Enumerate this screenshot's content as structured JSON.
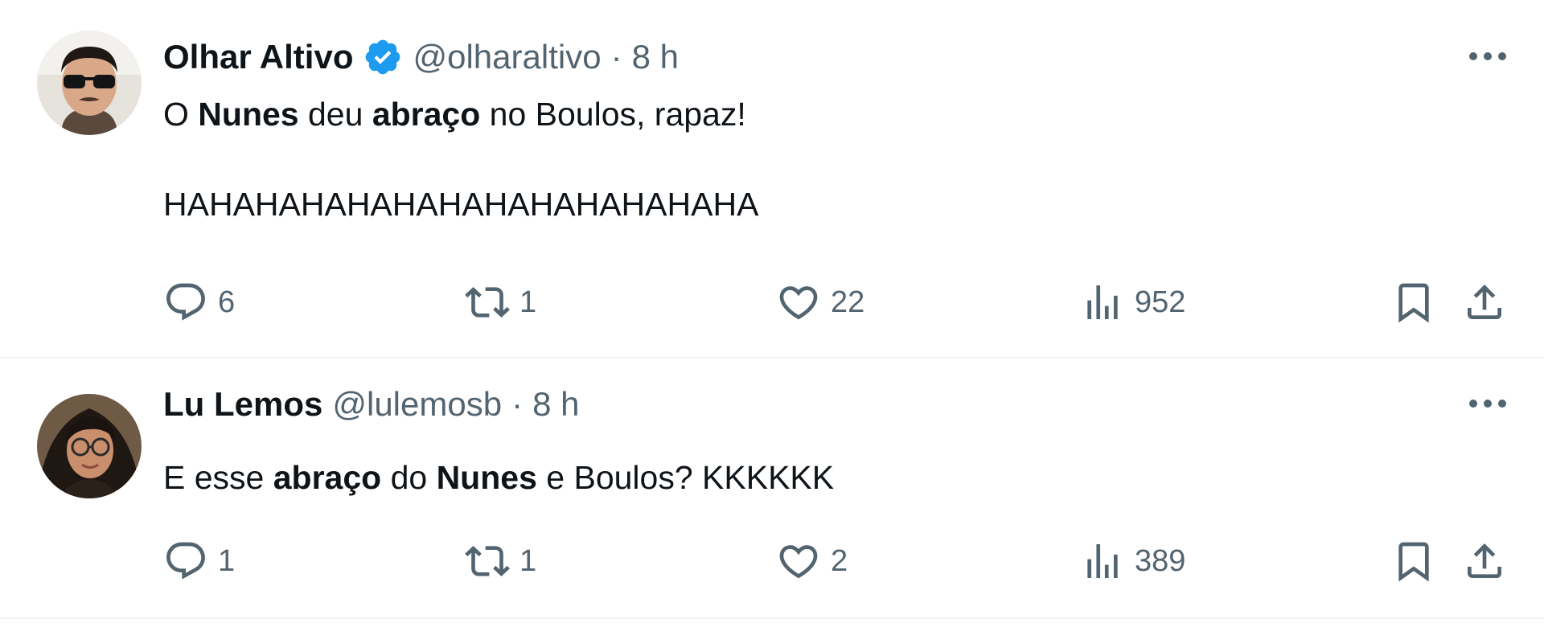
{
  "tweets": [
    {
      "author": "Olhar Altivo",
      "verified": true,
      "handle": "@olharaltivo",
      "separator": "·",
      "time": "8 h",
      "body_lines": [
        [
          {
            "t": "O ",
            "b": false
          },
          {
            "t": "Nunes",
            "b": true
          },
          {
            "t": " deu ",
            "b": false
          },
          {
            "t": "abraço",
            "b": true
          },
          {
            "t": " no Boulos, rapaz!",
            "b": false
          }
        ],
        [],
        [
          {
            "t": "HAHAHAHAHAHAHAHAHAHAHAHAHA",
            "b": false
          }
        ]
      ],
      "stats": {
        "replies": "6",
        "reposts": "1",
        "likes": "22",
        "views": "952"
      }
    },
    {
      "author": "Lu Lemos",
      "verified": false,
      "handle": "@lulemosb",
      "separator": "·",
      "time": "8 h",
      "body_lines": [
        [
          {
            "t": "E esse ",
            "b": false
          },
          {
            "t": "abraço",
            "b": true
          },
          {
            "t": " do ",
            "b": false
          },
          {
            "t": "Nunes",
            "b": true
          },
          {
            "t": " e Boulos? KKKKKK",
            "b": false
          }
        ]
      ],
      "stats": {
        "replies": "1",
        "reposts": "1",
        "likes": "2",
        "views": "389"
      }
    }
  ],
  "icons": {
    "more": "more-horizontal-icon",
    "verified": "verified-badge-icon",
    "reply": "reply-icon",
    "repost": "repost-icon",
    "like": "heart-icon",
    "views": "views-chart-icon",
    "bookmark": "bookmark-icon",
    "share": "share-icon"
  },
  "colors": {
    "text": "#0f1419",
    "secondary": "#536471",
    "verified_blue": "#1d9bf0",
    "divider": "#eff3f4"
  }
}
